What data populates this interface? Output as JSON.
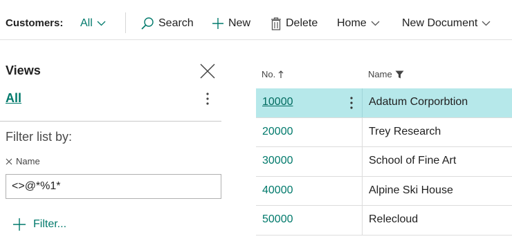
{
  "toolbar": {
    "title": "Customers:",
    "filter_label": "All",
    "search_label": "Search",
    "new_label": "New",
    "delete_label": "Delete",
    "home_label": "Home",
    "new_document_label": "New Document"
  },
  "views_panel": {
    "title": "Views",
    "selected_view": "All",
    "filter_heading": "Filter list by:",
    "filter_field_label": "Name",
    "filter_value": "<>@*%1*",
    "add_filter_label": "Filter..."
  },
  "list": {
    "columns": {
      "no": "No.",
      "name": "Name"
    },
    "rows": [
      {
        "no": "10000",
        "name": "Adatum Corporbtion"
      },
      {
        "no": "20000",
        "name": "Trey Research"
      },
      {
        "no": "30000",
        "name": "School of Fine Art"
      },
      {
        "no": "40000",
        "name": "Alpine Ski House"
      },
      {
        "no": "50000",
        "name": "Relecloud"
      }
    ]
  },
  "colors": {
    "accent": "#00796b",
    "selected_row": "#b6e8ea"
  }
}
